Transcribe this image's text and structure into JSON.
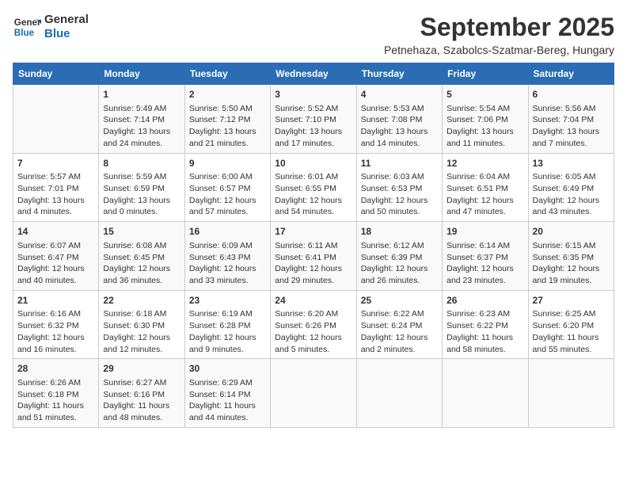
{
  "header": {
    "logo_line1": "General",
    "logo_line2": "Blue",
    "month": "September 2025",
    "location": "Petnehaza, Szabolcs-Szatmar-Bereg, Hungary"
  },
  "weekdays": [
    "Sunday",
    "Monday",
    "Tuesday",
    "Wednesday",
    "Thursday",
    "Friday",
    "Saturday"
  ],
  "weeks": [
    [
      {
        "day": "",
        "info": ""
      },
      {
        "day": "1",
        "info": "Sunrise: 5:49 AM\nSunset: 7:14 PM\nDaylight: 13 hours\nand 24 minutes."
      },
      {
        "day": "2",
        "info": "Sunrise: 5:50 AM\nSunset: 7:12 PM\nDaylight: 13 hours\nand 21 minutes."
      },
      {
        "day": "3",
        "info": "Sunrise: 5:52 AM\nSunset: 7:10 PM\nDaylight: 13 hours\nand 17 minutes."
      },
      {
        "day": "4",
        "info": "Sunrise: 5:53 AM\nSunset: 7:08 PM\nDaylight: 13 hours\nand 14 minutes."
      },
      {
        "day": "5",
        "info": "Sunrise: 5:54 AM\nSunset: 7:06 PM\nDaylight: 13 hours\nand 11 minutes."
      },
      {
        "day": "6",
        "info": "Sunrise: 5:56 AM\nSunset: 7:04 PM\nDaylight: 13 hours\nand 7 minutes."
      }
    ],
    [
      {
        "day": "7",
        "info": "Sunrise: 5:57 AM\nSunset: 7:01 PM\nDaylight: 13 hours\nand 4 minutes."
      },
      {
        "day": "8",
        "info": "Sunrise: 5:59 AM\nSunset: 6:59 PM\nDaylight: 13 hours\nand 0 minutes."
      },
      {
        "day": "9",
        "info": "Sunrise: 6:00 AM\nSunset: 6:57 PM\nDaylight: 12 hours\nand 57 minutes."
      },
      {
        "day": "10",
        "info": "Sunrise: 6:01 AM\nSunset: 6:55 PM\nDaylight: 12 hours\nand 54 minutes."
      },
      {
        "day": "11",
        "info": "Sunrise: 6:03 AM\nSunset: 6:53 PM\nDaylight: 12 hours\nand 50 minutes."
      },
      {
        "day": "12",
        "info": "Sunrise: 6:04 AM\nSunset: 6:51 PM\nDaylight: 12 hours\nand 47 minutes."
      },
      {
        "day": "13",
        "info": "Sunrise: 6:05 AM\nSunset: 6:49 PM\nDaylight: 12 hours\nand 43 minutes."
      }
    ],
    [
      {
        "day": "14",
        "info": "Sunrise: 6:07 AM\nSunset: 6:47 PM\nDaylight: 12 hours\nand 40 minutes."
      },
      {
        "day": "15",
        "info": "Sunrise: 6:08 AM\nSunset: 6:45 PM\nDaylight: 12 hours\nand 36 minutes."
      },
      {
        "day": "16",
        "info": "Sunrise: 6:09 AM\nSunset: 6:43 PM\nDaylight: 12 hours\nand 33 minutes."
      },
      {
        "day": "17",
        "info": "Sunrise: 6:11 AM\nSunset: 6:41 PM\nDaylight: 12 hours\nand 29 minutes."
      },
      {
        "day": "18",
        "info": "Sunrise: 6:12 AM\nSunset: 6:39 PM\nDaylight: 12 hours\nand 26 minutes."
      },
      {
        "day": "19",
        "info": "Sunrise: 6:14 AM\nSunset: 6:37 PM\nDaylight: 12 hours\nand 23 minutes."
      },
      {
        "day": "20",
        "info": "Sunrise: 6:15 AM\nSunset: 6:35 PM\nDaylight: 12 hours\nand 19 minutes."
      }
    ],
    [
      {
        "day": "21",
        "info": "Sunrise: 6:16 AM\nSunset: 6:32 PM\nDaylight: 12 hours\nand 16 minutes."
      },
      {
        "day": "22",
        "info": "Sunrise: 6:18 AM\nSunset: 6:30 PM\nDaylight: 12 hours\nand 12 minutes."
      },
      {
        "day": "23",
        "info": "Sunrise: 6:19 AM\nSunset: 6:28 PM\nDaylight: 12 hours\nand 9 minutes."
      },
      {
        "day": "24",
        "info": "Sunrise: 6:20 AM\nSunset: 6:26 PM\nDaylight: 12 hours\nand 5 minutes."
      },
      {
        "day": "25",
        "info": "Sunrise: 6:22 AM\nSunset: 6:24 PM\nDaylight: 12 hours\nand 2 minutes."
      },
      {
        "day": "26",
        "info": "Sunrise: 6:23 AM\nSunset: 6:22 PM\nDaylight: 11 hours\nand 58 minutes."
      },
      {
        "day": "27",
        "info": "Sunrise: 6:25 AM\nSunset: 6:20 PM\nDaylight: 11 hours\nand 55 minutes."
      }
    ],
    [
      {
        "day": "28",
        "info": "Sunrise: 6:26 AM\nSunset: 6:18 PM\nDaylight: 11 hours\nand 51 minutes."
      },
      {
        "day": "29",
        "info": "Sunrise: 6:27 AM\nSunset: 6:16 PM\nDaylight: 11 hours\nand 48 minutes."
      },
      {
        "day": "30",
        "info": "Sunrise: 6:29 AM\nSunset: 6:14 PM\nDaylight: 11 hours\nand 44 minutes."
      },
      {
        "day": "",
        "info": ""
      },
      {
        "day": "",
        "info": ""
      },
      {
        "day": "",
        "info": ""
      },
      {
        "day": "",
        "info": ""
      }
    ]
  ]
}
